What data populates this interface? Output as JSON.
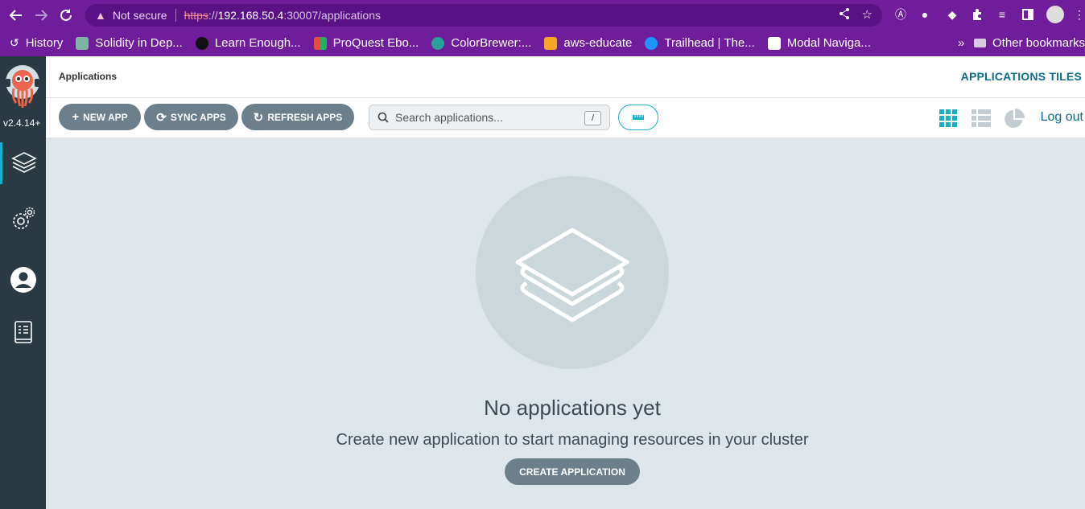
{
  "browser": {
    "url_warning": "Not secure",
    "url_scheme": "https",
    "url_scheme_rest": "://",
    "url_host": "192.168.50.4",
    "url_path": ":30007/applications"
  },
  "bookmarks": {
    "items": [
      {
        "label": "History",
        "color": "#ffffff"
      },
      {
        "label": "Solidity in Dep...",
        "color": "#7fb3a3"
      },
      {
        "label": "Learn Enough...",
        "color": "#111111"
      },
      {
        "label": "ProQuest Ebo...",
        "color": "#e74c3c"
      },
      {
        "label": "ColorBrewer:...",
        "color": "#2aa198"
      },
      {
        "label": "aws-educate",
        "color": "#f5a623"
      },
      {
        "label": "Trailhead | The...",
        "color": "#1b96ff"
      },
      {
        "label": "Modal Naviga...",
        "color": "#ffffff"
      }
    ],
    "overflow": "»",
    "other": "Other bookmarks"
  },
  "sidebar": {
    "version": "v2.4.14+",
    "items": [
      {
        "name": "applications",
        "icon": "layers-icon"
      },
      {
        "name": "settings",
        "icon": "gear-icon"
      },
      {
        "name": "user-info",
        "icon": "user-icon"
      },
      {
        "name": "docs",
        "icon": "docs-icon"
      }
    ]
  },
  "topbar": {
    "title": "Applications",
    "view_title": "APPLICATIONS TILES"
  },
  "toolbar": {
    "new_app": "NEW APP",
    "sync_apps": "SYNC APPS",
    "refresh_apps": "REFRESH APPS",
    "search_placeholder": "Search applications...",
    "search_shortcut": "/",
    "logout": "Log out",
    "accent": "#18b0c9"
  },
  "empty": {
    "title": "No applications yet",
    "subtitle": "Create new application to start managing resources in your cluster",
    "create_button": "CREATE APPLICATION"
  }
}
